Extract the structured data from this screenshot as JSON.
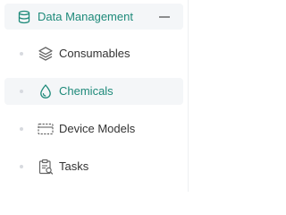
{
  "menu": {
    "group": {
      "label": "Data Management",
      "icon": "database-icon",
      "toggle_icon": "minus-icon",
      "expanded": true
    },
    "items": [
      {
        "label": "Consumables",
        "icon": "layers-icon",
        "active": false
      },
      {
        "label": "Chemicals",
        "icon": "droplet-icon",
        "active": true
      },
      {
        "label": "Device Models",
        "icon": "device-icon",
        "active": false
      },
      {
        "label": "Tasks",
        "icon": "clipboard-icon",
        "active": false
      }
    ]
  },
  "colors": {
    "accent": "#1e8a7a",
    "text": "#333333",
    "icon": "#666666",
    "active_bg": "#f4f6f8",
    "bullet": "#d7dadf"
  }
}
